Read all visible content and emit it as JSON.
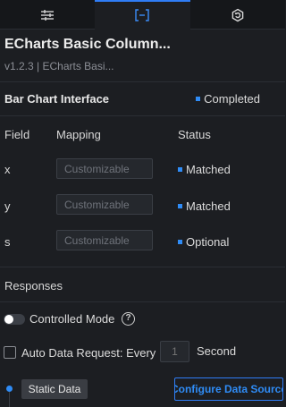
{
  "tabs": [
    {
      "icon": "sliders-icon",
      "active": false
    },
    {
      "icon": "bracket-data-icon",
      "active": true
    },
    {
      "icon": "refresh-hexagon-icon",
      "active": false
    }
  ],
  "component": {
    "title": "ECharts Basic Column...",
    "subtitle": "v1.2.3 | ECharts Basi..."
  },
  "interface": {
    "title": "Bar Chart Interface",
    "status": "Completed"
  },
  "mapping_table": {
    "headers": {
      "field": "Field",
      "mapping": "Mapping",
      "status": "Status"
    },
    "rows": [
      {
        "field": "x",
        "placeholder": "Customizable",
        "status": "Matched"
      },
      {
        "field": "y",
        "placeholder": "Customizable",
        "status": "Matched"
      },
      {
        "field": "s",
        "placeholder": "Customizable",
        "status": "Optional"
      }
    ]
  },
  "responses": {
    "title": "Responses",
    "controlled_mode_label": "Controlled Mode",
    "controlled_mode_on": false,
    "help_glyph": "?",
    "auto_request_label": "Auto Data Request: Every",
    "auto_request_checked": false,
    "interval_placeholder": "1",
    "interval_unit": "Second"
  },
  "data_source": {
    "type_label": "Static Data",
    "configure_label": "Configure Data Source"
  },
  "colors": {
    "accent": "#2f8cf6",
    "background": "#1c1e22",
    "tabbar": "#15171a"
  }
}
